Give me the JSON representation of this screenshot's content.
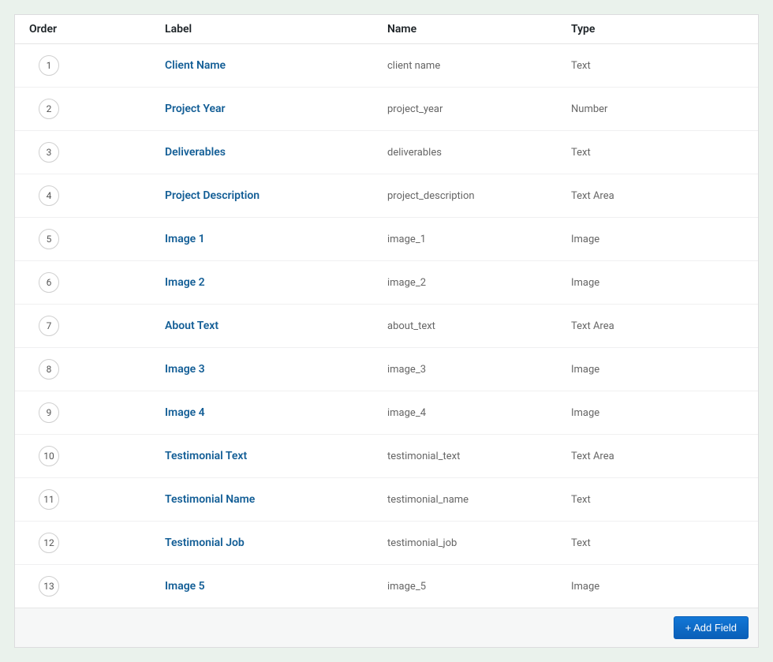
{
  "headers": {
    "order": "Order",
    "label": "Label",
    "name": "Name",
    "type": "Type"
  },
  "rows": [
    {
      "order": "1",
      "label": "Client Name",
      "name": "client name",
      "type": "Text"
    },
    {
      "order": "2",
      "label": "Project Year",
      "name": "project_year",
      "type": "Number"
    },
    {
      "order": "3",
      "label": "Deliverables",
      "name": "deliverables",
      "type": "Text"
    },
    {
      "order": "4",
      "label": "Project Description",
      "name": "project_description",
      "type": "Text Area"
    },
    {
      "order": "5",
      "label": "Image 1",
      "name": "image_1",
      "type": "Image"
    },
    {
      "order": "6",
      "label": "Image 2",
      "name": "image_2",
      "type": "Image"
    },
    {
      "order": "7",
      "label": "About Text",
      "name": "about_text",
      "type": "Text Area"
    },
    {
      "order": "8",
      "label": "Image 3",
      "name": "image_3",
      "type": "Image"
    },
    {
      "order": "9",
      "label": "Image 4",
      "name": "image_4",
      "type": "Image"
    },
    {
      "order": "10",
      "label": "Testimonial Text",
      "name": "testimonial_text",
      "type": "Text Area"
    },
    {
      "order": "11",
      "label": "Testimonial Name",
      "name": "testimonial_name",
      "type": "Text"
    },
    {
      "order": "12",
      "label": "Testimonial Job",
      "name": "testimonial_job",
      "type": "Text"
    },
    {
      "order": "13",
      "label": "Image 5",
      "name": "image_5",
      "type": "Image"
    }
  ],
  "footer": {
    "add_field": "+ Add Field"
  }
}
